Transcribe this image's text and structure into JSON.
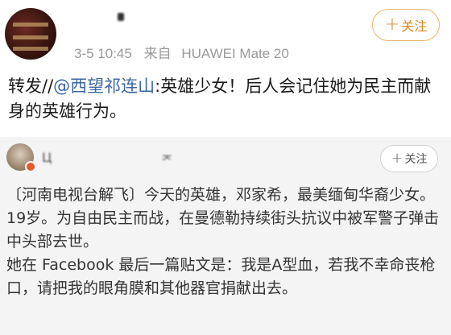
{
  "post": {
    "meta": {
      "time": "3-5 10:45",
      "source_prefix": "来自",
      "source_device": "HUAWEI Mate 20"
    },
    "follow_label": "关注",
    "text": {
      "prefix": "转发//",
      "mention": "@西望祁连山",
      "body": ":英雄少女！后人会记住她为民主而献身的英雄行为。"
    }
  },
  "repost": {
    "username_parts": [
      "Ц",
      "ᅎ"
    ],
    "follow_label": "关注",
    "paragraphs": [
      "〔河南电视台解飞〕今天的英雄，邓家希，最美缅甸华裔少女。19岁。为自由民主而战，在曼德勒持续街头抗议中被军警子弹击中头部去世。",
      "她在 Facebook 最后一篇贴文是：我是A型血，若我不幸命丧枪口，请把我的眼角膜和其他器官捐献出去。"
    ]
  },
  "colors": {
    "accent_orange": "#e7b36a",
    "link_blue": "#3b67a5",
    "meta_gray": "#9a9a9a",
    "repost_bg": "#f4f4f4"
  }
}
